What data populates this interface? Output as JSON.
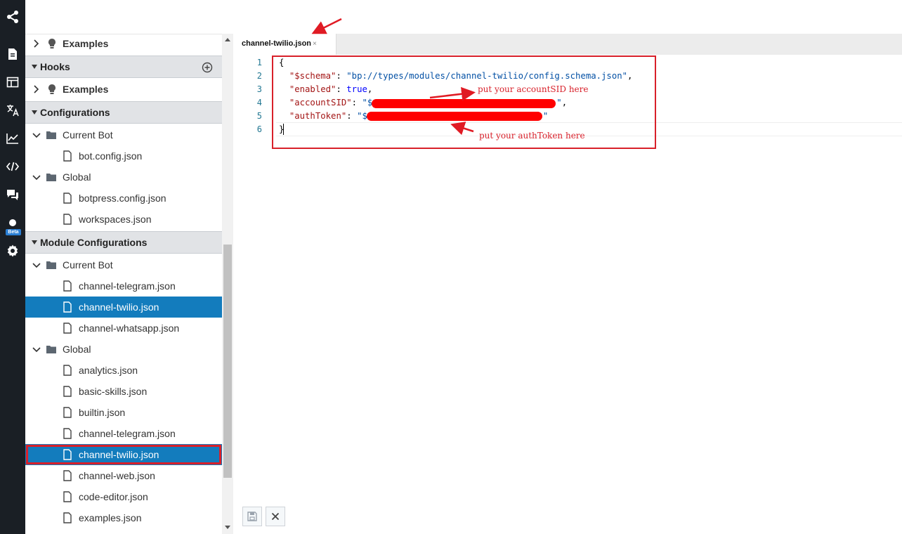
{
  "sidebar_nav": {
    "items": [
      {
        "icon": "share-network-icon"
      },
      {
        "icon": "document-icon"
      },
      {
        "icon": "layout-icon"
      },
      {
        "icon": "translate-icon"
      },
      {
        "icon": "analytics-chart-icon"
      },
      {
        "icon": "code-icon"
      },
      {
        "icon": "chat-bubbles-icon"
      },
      {
        "icon": "dot-icon",
        "badge": "Beta"
      },
      {
        "icon": "gear-icon"
      }
    ]
  },
  "explorer": {
    "hooks_examples": "Examples",
    "hooks_label": "Hooks",
    "hooks_examples_2": "Examples",
    "configurations_label": "Configurations",
    "config_current_bot": "Current Bot",
    "config_bot_file": "bot.config.json",
    "config_global": "Global",
    "config_global_files": [
      "botpress.config.json",
      "workspaces.json"
    ],
    "module_configurations_label": "Module Configurations",
    "module_current_bot": "Current Bot",
    "module_current_bot_files": [
      "channel-telegram.json",
      "channel-twilio.json",
      "channel-whatsapp.json"
    ],
    "module_global": "Global",
    "module_global_files": [
      "analytics.json",
      "basic-skills.json",
      "builtin.json",
      "channel-telegram.json",
      "channel-twilio.json",
      "channel-web.json",
      "code-editor.json",
      "examples.json"
    ]
  },
  "editor": {
    "tab_label": "channel-twilio.json",
    "tab_close": "×",
    "line_numbers": [
      "1",
      "2",
      "3",
      "4",
      "5",
      "6"
    ],
    "code": {
      "open": "{",
      "schema_key": "\"$schema\"",
      "schema_value": "\"bp://types/modules/channel-twilio/config.schema.json\"",
      "enabled_key": "\"enabled\"",
      "enabled_value": "true",
      "account_key": "\"accountSID\"",
      "account_value_start": "\"$",
      "account_value_end": "\"",
      "auth_key": "\"authToken\"",
      "auth_value_start": "\"$",
      "auth_value_end": "\"",
      "close": "}"
    },
    "annotations": {
      "account_hint": "put your accountSID here",
      "auth_hint": "put your authToken here"
    }
  },
  "colors": {
    "rail_bg": "#1a1f25",
    "selected_bg": "#137cbd",
    "annotation_red": "#d8202a"
  }
}
